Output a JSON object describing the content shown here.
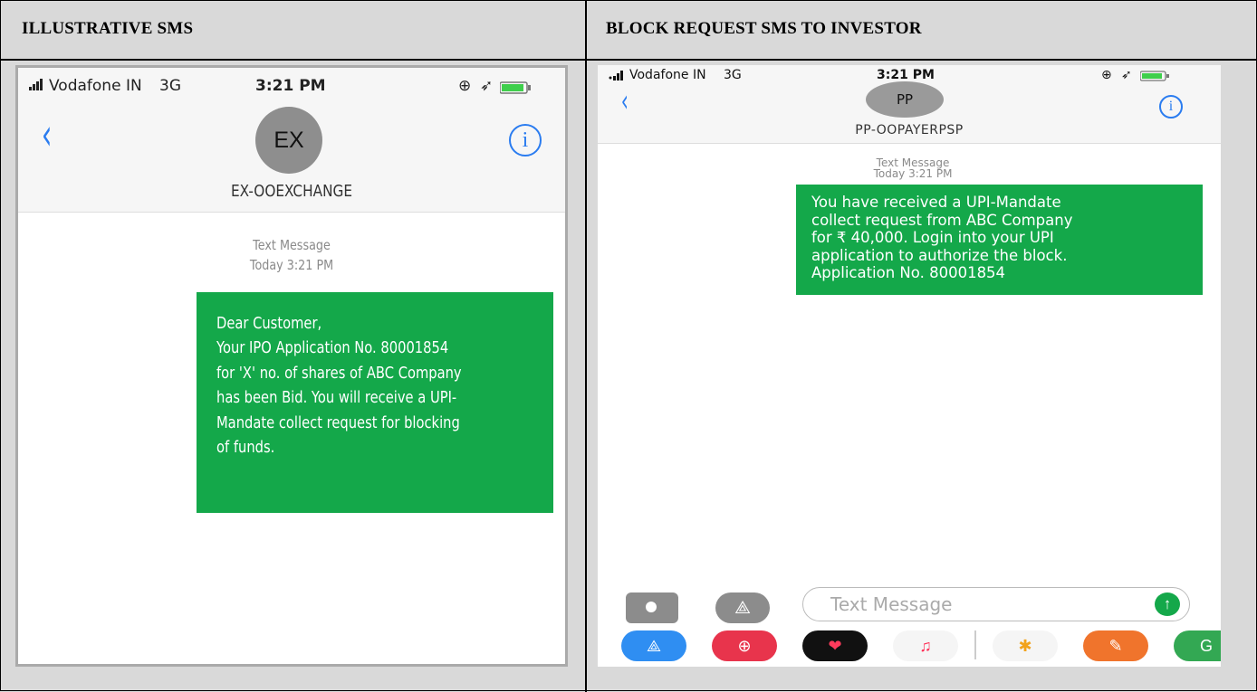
{
  "table": {
    "col1_header": "ILLUSTRATIVE SMS",
    "col2_header": "BLOCK REQUEST SMS TO INVESTOR"
  },
  "left_phone": {
    "carrier": "Vodafone IN",
    "network": "3G",
    "time": "3:21 PM",
    "avatar_initials": "EX",
    "sender": "EX-OOEXCHANGE",
    "message_type": "Text Message",
    "message_time": "Today 3:21 PM",
    "message_lines": [
      "Dear Customer,",
      "Your IPO Application No. 80001854",
      "for 'X' no. of shares of ABC Company",
      "has been Bid. You will receive a UPI-",
      "Mandate collect request for blocking",
      "of funds."
    ],
    "bubble_color": "#14a84a",
    "accent_color": "#2a7cf0"
  },
  "right_phone": {
    "carrier": "Vodafone IN",
    "network": "3G",
    "time": "3:21 PM",
    "avatar_initials": "PP",
    "sender": "PP-OOPAYERPSP",
    "message_type": "Text Message",
    "message_time": "Today 3:21 PM",
    "message_lines": [
      "You have received a UPI-Mandate",
      "collect request from ABC Company",
      "for ₹ 40,000. Login into your UPI",
      "application to authorize the block.",
      "Application No. 80001854"
    ],
    "input_placeholder": "Text Message",
    "bubble_color": "#14a84a",
    "accent_color": "#2a7cf0"
  }
}
